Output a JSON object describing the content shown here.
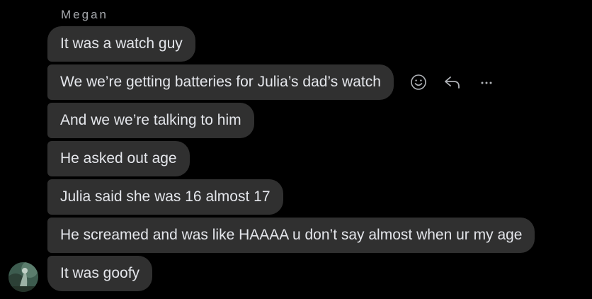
{
  "chat": {
    "sender": "Megan",
    "messages": [
      {
        "text": "It was a watch guy"
      },
      {
        "text": "We we’re getting batteries for Julia’s dad’s watch"
      },
      {
        "text": "And we we’re talking to him"
      },
      {
        "text": "He asked out age"
      },
      {
        "text": "Julia said she was 16 almost 17"
      },
      {
        "text": "He screamed and was like HAAAA u don’t say almost when ur my age"
      },
      {
        "text": "It was goofy"
      }
    ],
    "hover_actions": {
      "react_icon": "smiley-icon",
      "reply_icon": "reply-arrow-icon",
      "more_icon": "ellipsis-icon"
    }
  },
  "colors": {
    "background": "#000000",
    "bubble": "#303030",
    "text": "#e4e6eb",
    "name": "#a8abaf",
    "icon": "#b0b3b8"
  }
}
